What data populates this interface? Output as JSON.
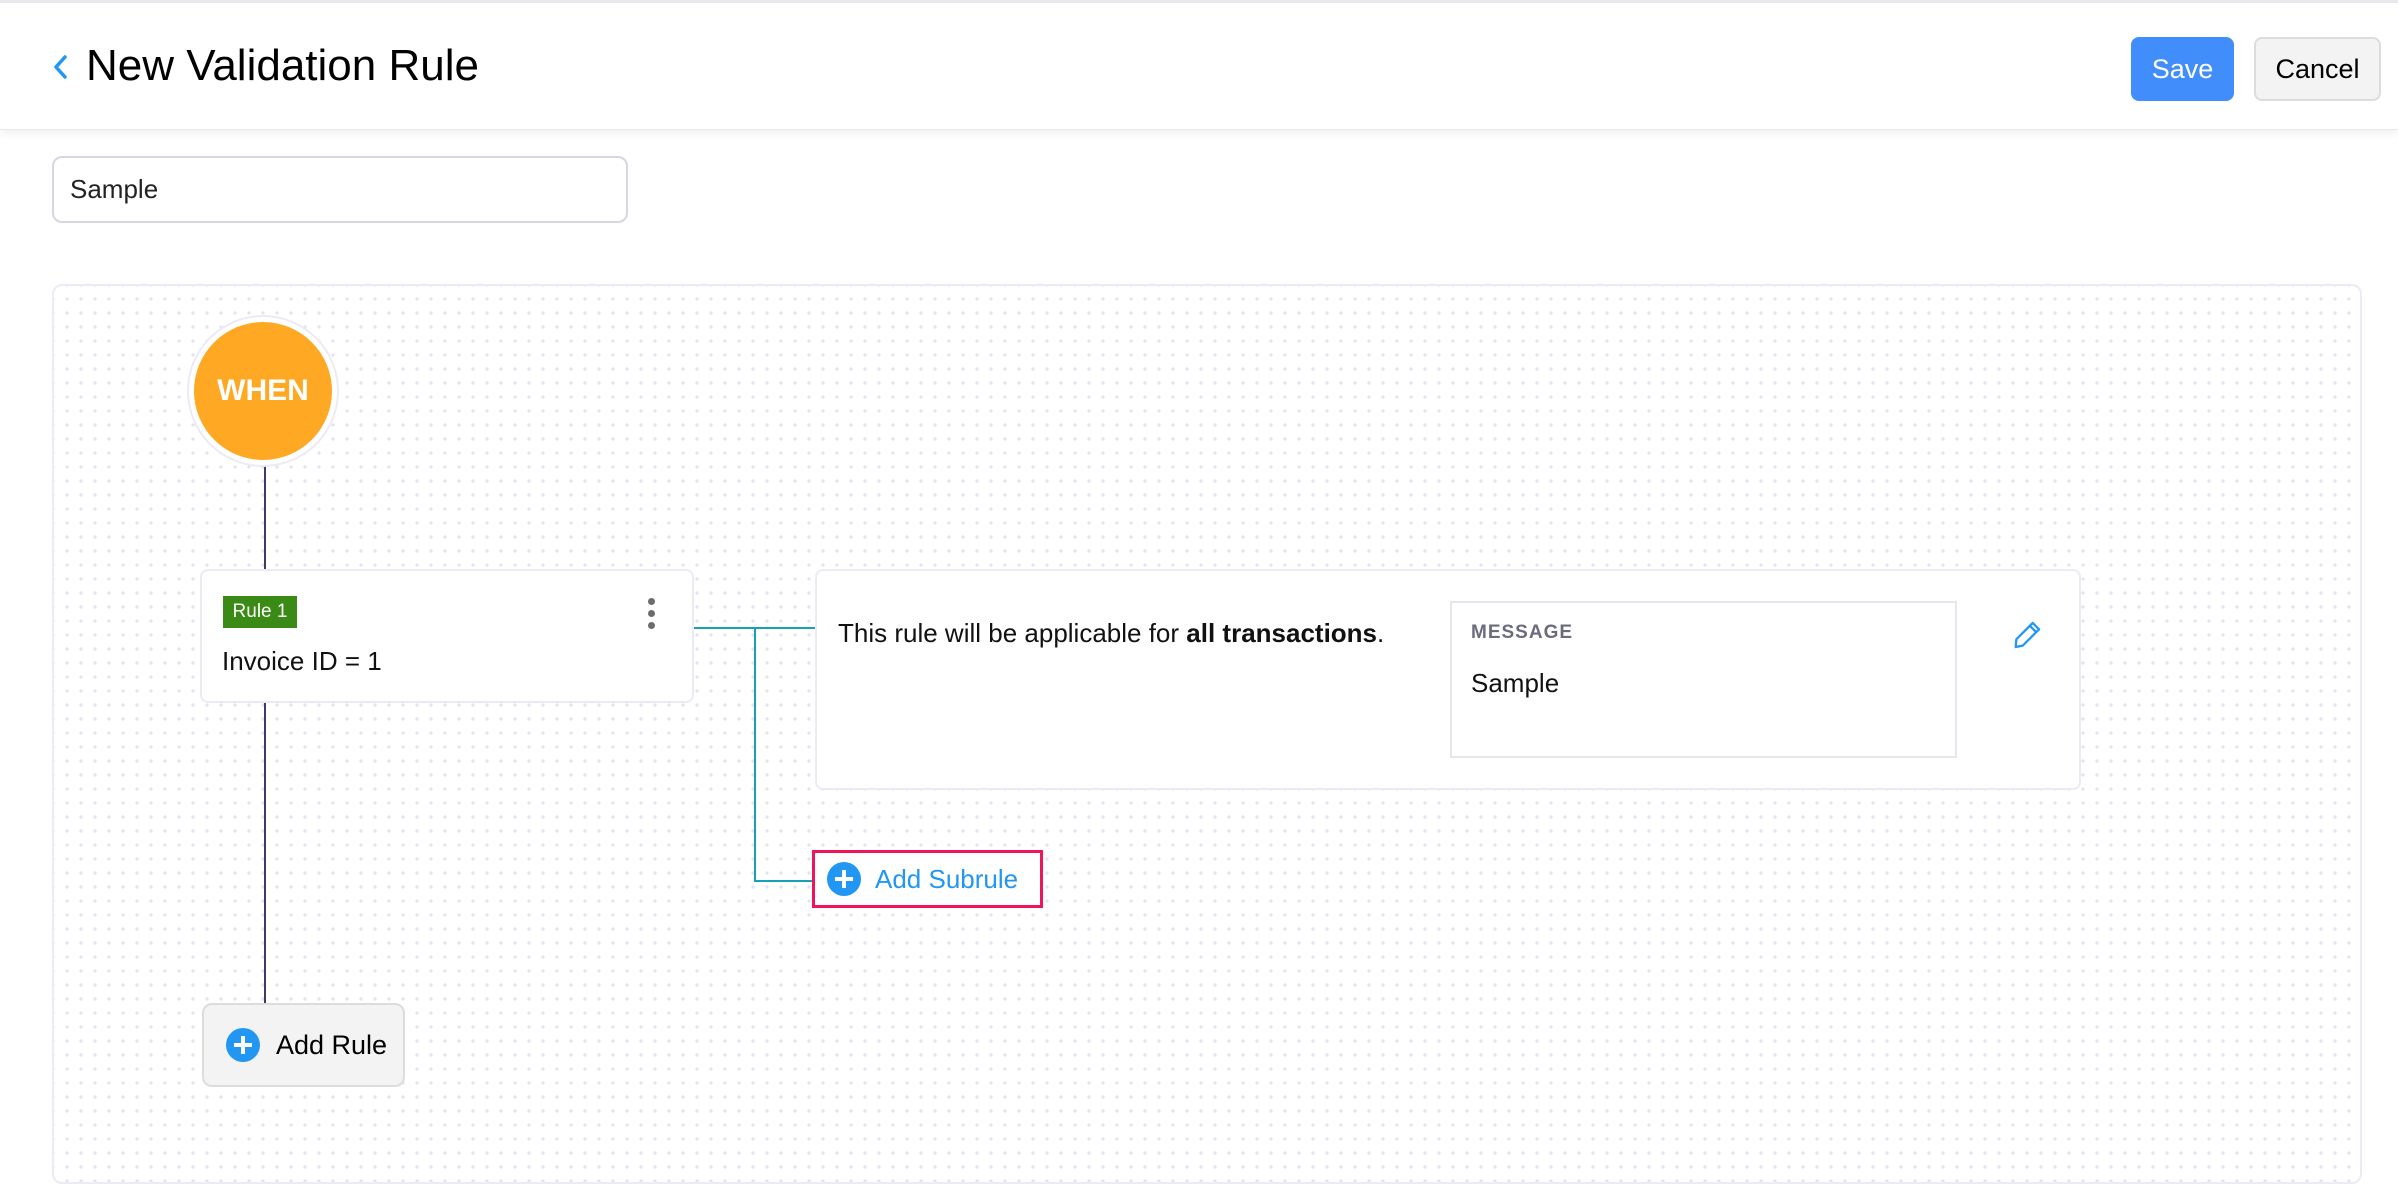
{
  "header": {
    "title": "New Validation Rule",
    "save_label": "Save",
    "cancel_label": "Cancel"
  },
  "rule_name": {
    "value": "Sample"
  },
  "flow": {
    "start_label": "WHEN",
    "rules": [
      {
        "badge": "Rule 1",
        "condition": "Invoice ID = 1",
        "action": {
          "text_prefix": "This rule will be applicable for ",
          "text_bold": "all transactions",
          "text_suffix": ".",
          "message_label": "MESSAGE",
          "message_value": "Sample"
        }
      }
    ],
    "add_subrule_label": "Add Subrule",
    "add_rule_label": "Add Rule"
  },
  "colors": {
    "accent": "#408dfb",
    "when": "#fea823",
    "rule_badge": "#3a8a16",
    "connector": "#18a0b5",
    "highlight": "#f0145a",
    "add_icon": "#2196f3"
  }
}
